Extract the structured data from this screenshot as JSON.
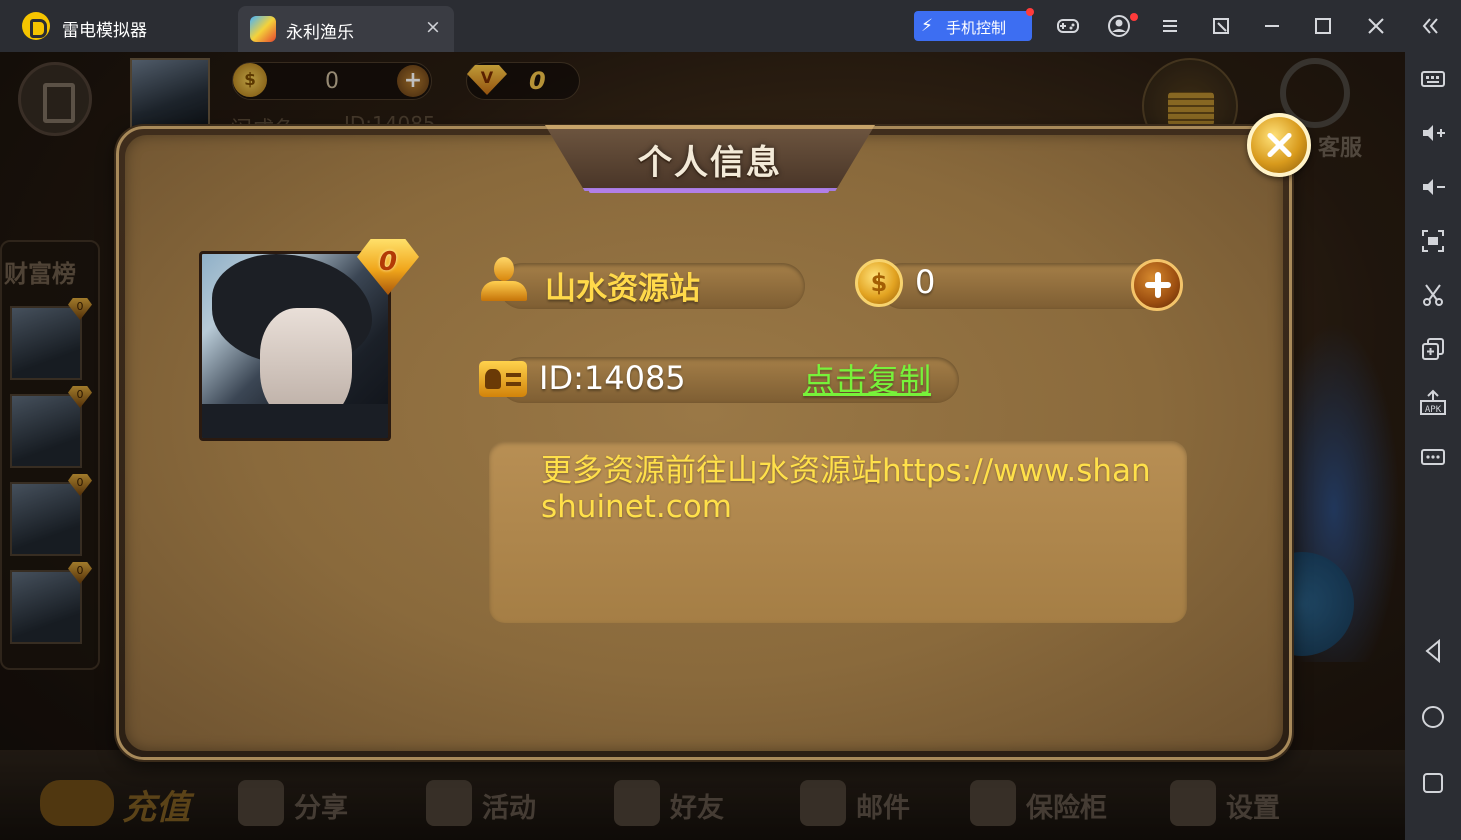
{
  "emulator": {
    "app_name": "雷电模拟器",
    "tab_title": "永利渔乐",
    "tab_close": "×",
    "phone_control": "手机控制",
    "toolbar_icons": [
      "gamepad-icon",
      "account-icon",
      "menu-icon",
      "shrink-window-icon",
      "minimize-icon",
      "maximize-icon",
      "close-icon",
      "collapse-sidebar-icon"
    ],
    "sidebar_icons": [
      "keyboard-icon",
      "volume-up-icon",
      "volume-down-icon",
      "screenshot-icon",
      "scissors-icon",
      "multi-instance-icon",
      "install-apk-icon",
      "more-icon",
      "back-icon",
      "home-icon",
      "recents-icon"
    ],
    "sidebar_apk": "APK"
  },
  "hud": {
    "coins": "0",
    "vip_level": "0",
    "player_name_partial": "闷成鱼",
    "player_id_partial": "ID:14085",
    "customer_service": "客服"
  },
  "leaderboard": {
    "title": "财富榜",
    "rows": [
      {
        "badge": "0"
      },
      {
        "badge": "0"
      },
      {
        "badge": "0"
      },
      {
        "badge": "0"
      }
    ]
  },
  "bottom_bar": {
    "recharge": "充值",
    "share": "分享",
    "activity": "活动",
    "friends": "好友",
    "mail": "邮件",
    "safe": "保险柜",
    "settings": "设置"
  },
  "modal": {
    "title": "个人信息",
    "vip_level": "0",
    "username": "山水资源站",
    "coins": "0",
    "id_text": "ID:14085",
    "copy_link": "点击复制",
    "signature": "更多资源前往山水资源站https://www.shanshuinet.com"
  },
  "colors": {
    "accent_gold": "#ffd94a",
    "copy_link": "#77f23a",
    "phone_control_blue": "#3d6ef2",
    "titlebar": "#2b2d33"
  }
}
